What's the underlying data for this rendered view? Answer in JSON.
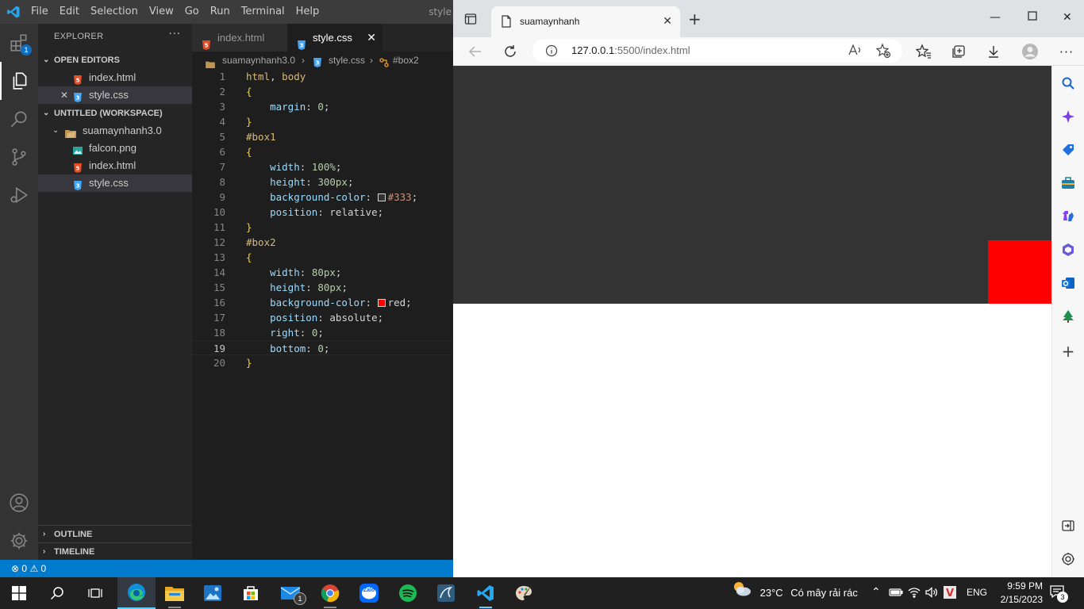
{
  "vscode": {
    "menu": [
      "File",
      "Edit",
      "Selection",
      "View",
      "Go",
      "Run",
      "Terminal",
      "Help"
    ],
    "title": "style",
    "activity_badge": "1",
    "explorer": {
      "header": "EXPLORER",
      "more": "···",
      "open_editors_title": "OPEN EDITORS",
      "open_editors": [
        {
          "name": "index.html",
          "type": "html"
        },
        {
          "name": "style.css",
          "type": "css"
        }
      ],
      "workspace_title": "UNTITLED (WORKSPACE)",
      "folder": "suamaynhanh3.0",
      "files": [
        {
          "name": "falcon.png",
          "type": "png"
        },
        {
          "name": "index.html",
          "type": "html"
        },
        {
          "name": "style.css",
          "type": "css"
        }
      ],
      "outline_title": "OUTLINE",
      "timeline_title": "TIMELINE"
    },
    "tabs": [
      {
        "name": "index.html",
        "active": false
      },
      {
        "name": "style.css",
        "active": true
      }
    ],
    "breadcrumb": {
      "folder": "suamaynhanh3.0",
      "file": "style.css",
      "symbol": "#box2"
    },
    "current_line": 19,
    "status": {
      "errors": "0",
      "warnings": "0"
    }
  },
  "browser": {
    "tab_title": "suamaynhanh",
    "url_host": "127.0.0.1",
    "url_rest": ":5500/index.html",
    "page": {
      "box1_color": "#333333",
      "box2_color": "#ff0000"
    }
  },
  "taskbar": {
    "mail_badge": "1",
    "zalo_label": "Zalo",
    "weather_temp": "23°C",
    "weather_text": "Có mây rải rác",
    "lang": "ENG",
    "time": "9:59 PM",
    "date": "2/15/2023",
    "notif_count": "3"
  }
}
